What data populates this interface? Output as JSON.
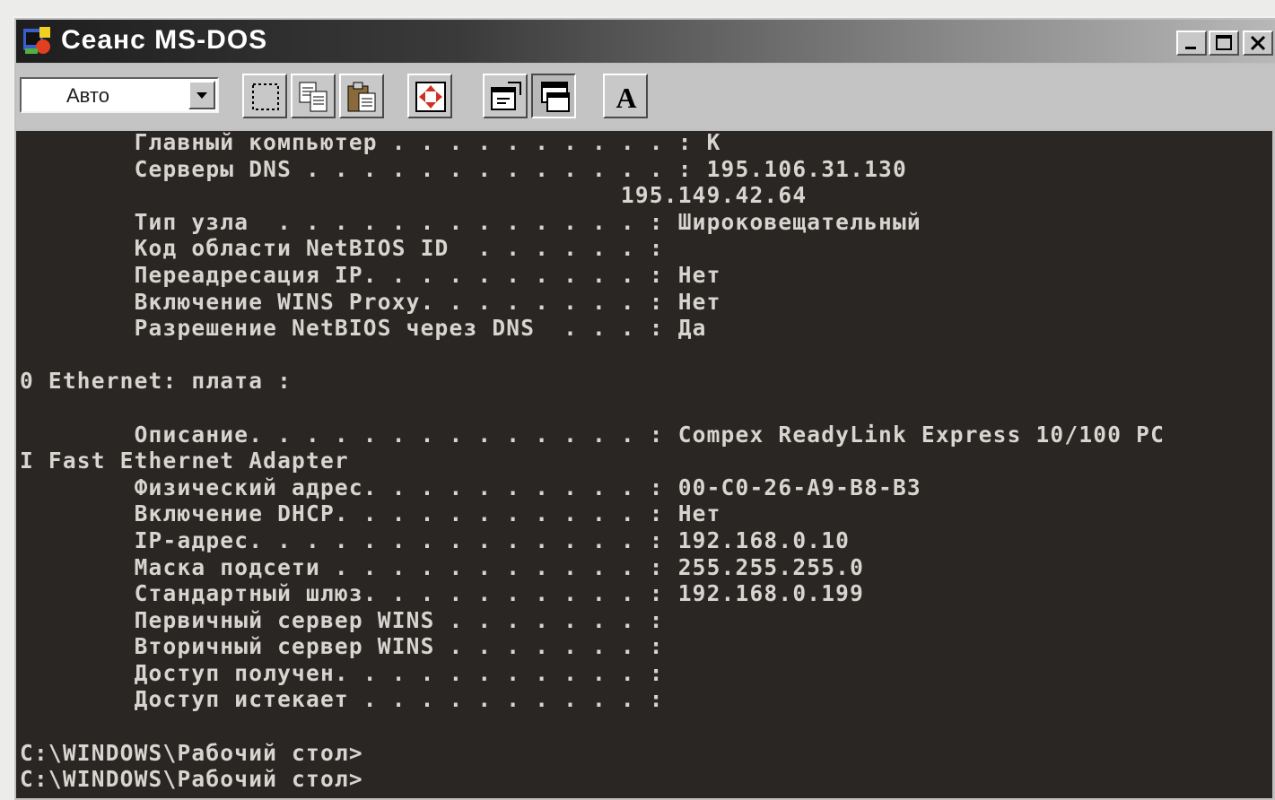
{
  "window": {
    "title": "Сеанс MS-DOS"
  },
  "titlebar_buttons": [
    "minimize-icon",
    "maximize-icon",
    "close-icon"
  ],
  "toolbar": {
    "font_size_value": "Авто",
    "buttons": [
      "mark-icon",
      "copy-icon",
      "paste-icon",
      "fullscreen-icon",
      "properties-icon",
      "background-icon",
      "font-icon"
    ],
    "font_button_glyph": "A"
  },
  "console": {
    "lines": [
      "        Главный компьютер . . . . . . . . . . : K",
      "        Серверы DNS . . . . . . . . . . . . . : 195.106.31.130",
      "                                          195.149.42.64",
      "        Тип узла  . . . . . . . . . . . . . : Широковещательный",
      "        Код области NetBIOS ID  . . . . . . :",
      "        Переадресация IP. . . . . . . . . . : Нет",
      "        Включение WINS Proxy. . . . . . . . : Нет",
      "        Разрешение NetBIOS через DNS  . . . : Да",
      "",
      "0 Ethernet: плата :",
      "",
      "        Описание. . . . . . . . . . . . . . : Compex ReadyLink Express 10/100 PC",
      "I Fast Ethernet Adapter",
      "        Физический адрес. . . . . . . . . . : 00-C0-26-A9-B8-B3",
      "        Включение DHCP. . . . . . . . . . . : Нет",
      "        IP-адрес. . . . . . . . . . . . . . : 192.168.0.10",
      "        Маска подсети . . . . . . . . . . . : 255.255.255.0",
      "        Стандартный шлюз. . . . . . . . . . : 192.168.0.199",
      "        Первичный сервер WINS . . . . . . . :",
      "        Вторичный сервер WINS . . . . . . . :",
      "        Доступ получен. . . . . . . . . . . :",
      "        Доступ истекает . . . . . . . . . . :",
      "",
      "C:\\WINDOWS\\Рабочий стол>",
      "C:\\WINDOWS\\Рабочий стол>"
    ]
  },
  "colors": {
    "console_bg": "#2a2624",
    "console_fg": "#d8d4d0",
    "chrome": "#c0c0c0"
  }
}
